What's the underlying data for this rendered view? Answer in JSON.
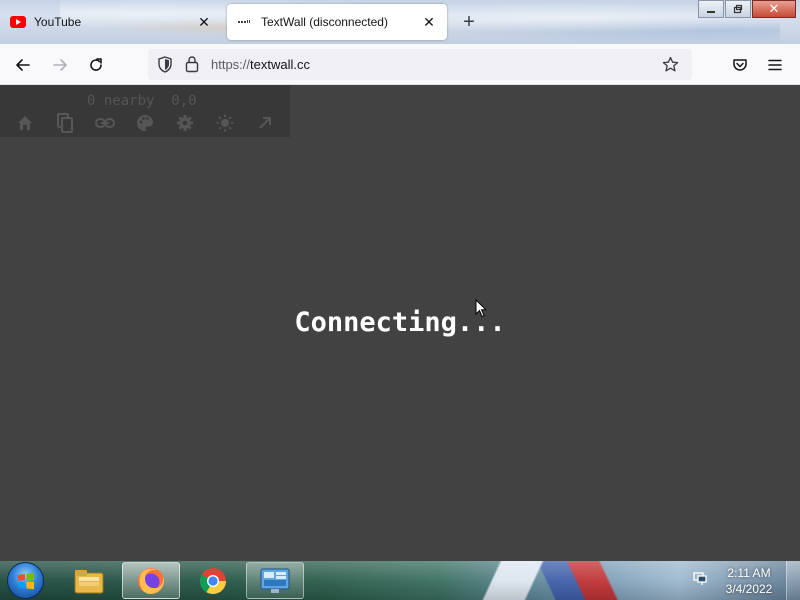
{
  "browser": {
    "tabs": [
      {
        "label": "YouTube",
        "favicon": "youtube-icon",
        "active": false
      },
      {
        "label": "TextWall (disconnected)",
        "favicon": "textwall-icon",
        "active": true
      }
    ],
    "new_tab": "+",
    "url": {
      "scheme": "https://",
      "host": "textwall.cc"
    }
  },
  "page": {
    "status_line": "0 nearby  0,0",
    "tools": [
      "home-icon",
      "copy-icon",
      "link-icon",
      "palette-icon",
      "gear-icon",
      "sun-icon",
      "arrow-up-right-icon"
    ],
    "message": "Connecting...",
    "background_color": "#424242"
  },
  "taskbar": {
    "clock": {
      "time": "2:11 AM",
      "date": "3/4/2022"
    },
    "items": [
      "file-explorer-icon",
      "firefox-icon",
      "chrome-icon",
      "control-panel-icon"
    ]
  }
}
